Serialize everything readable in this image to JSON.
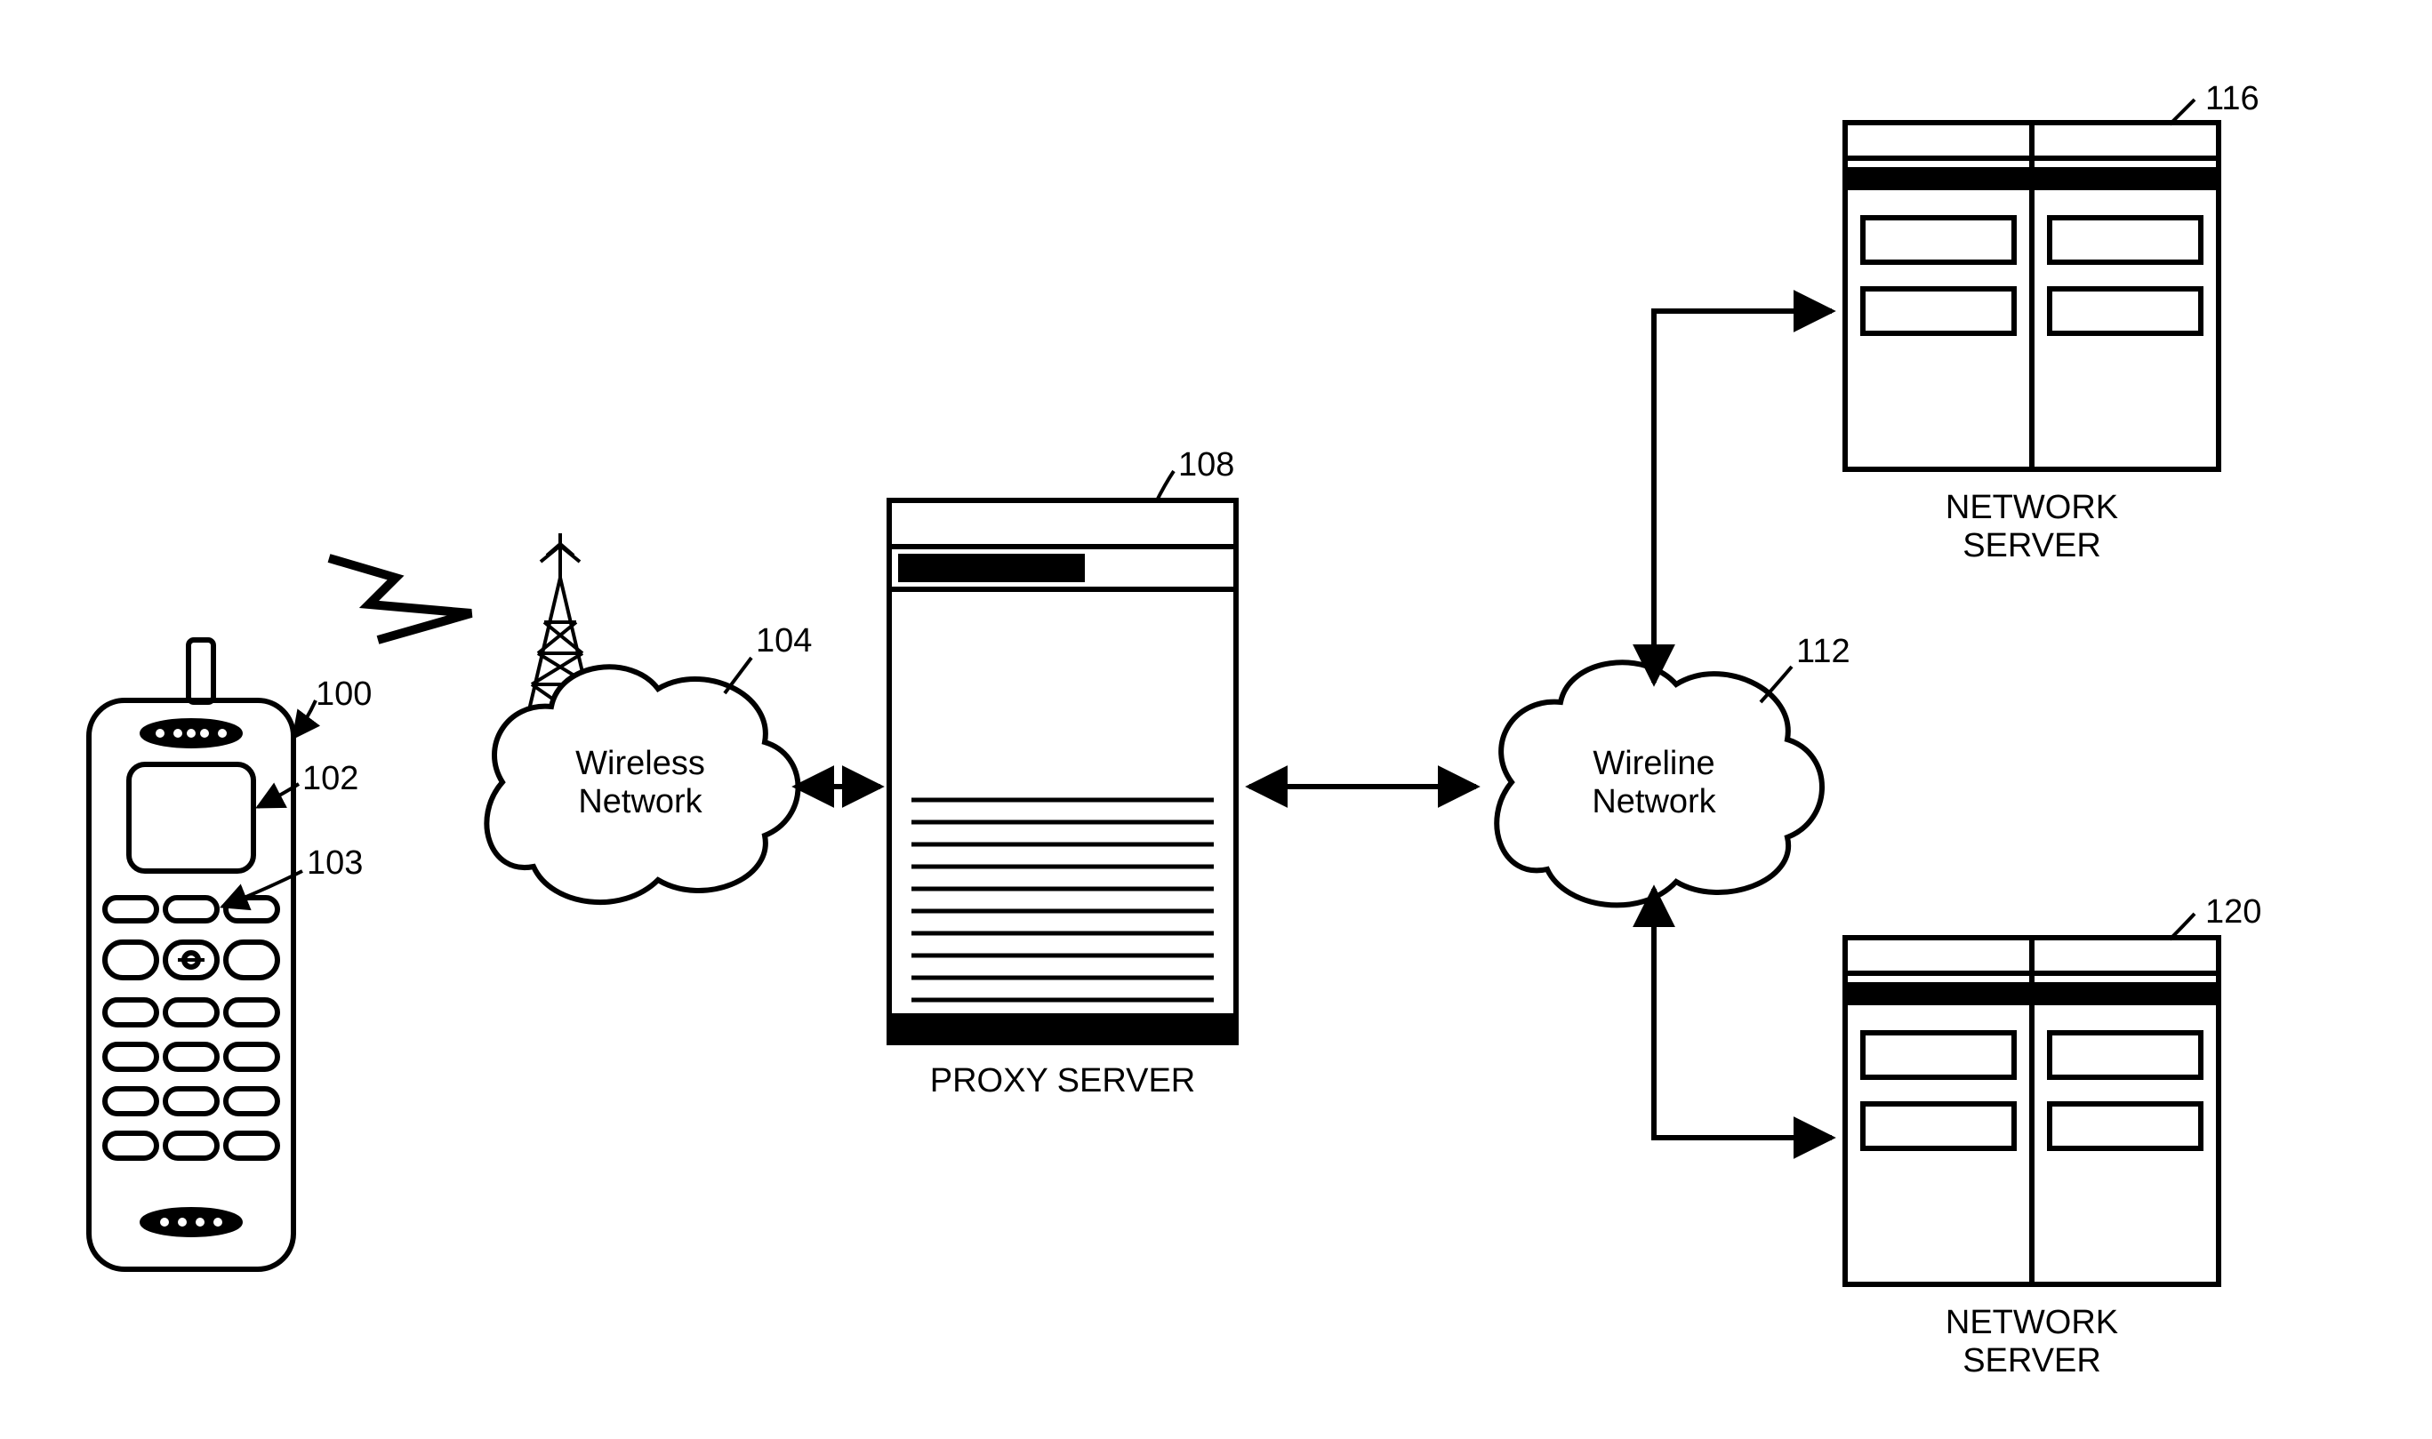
{
  "refs": {
    "phone_body": "100",
    "phone_display": "102",
    "phone_key": "103",
    "wireless_cloud": "104",
    "proxy_server": "108",
    "wireline_cloud": "112",
    "server_top": "116",
    "server_bottom": "120"
  },
  "labels": {
    "wireless_network": "Wireless\nNetwork",
    "wireline_network": "Wireline\nNetwork",
    "proxy_server": "PROXY SERVER",
    "network_server_top": "NETWORK\nSERVER",
    "network_server_bottom": "NETWORK\nSERVER"
  }
}
